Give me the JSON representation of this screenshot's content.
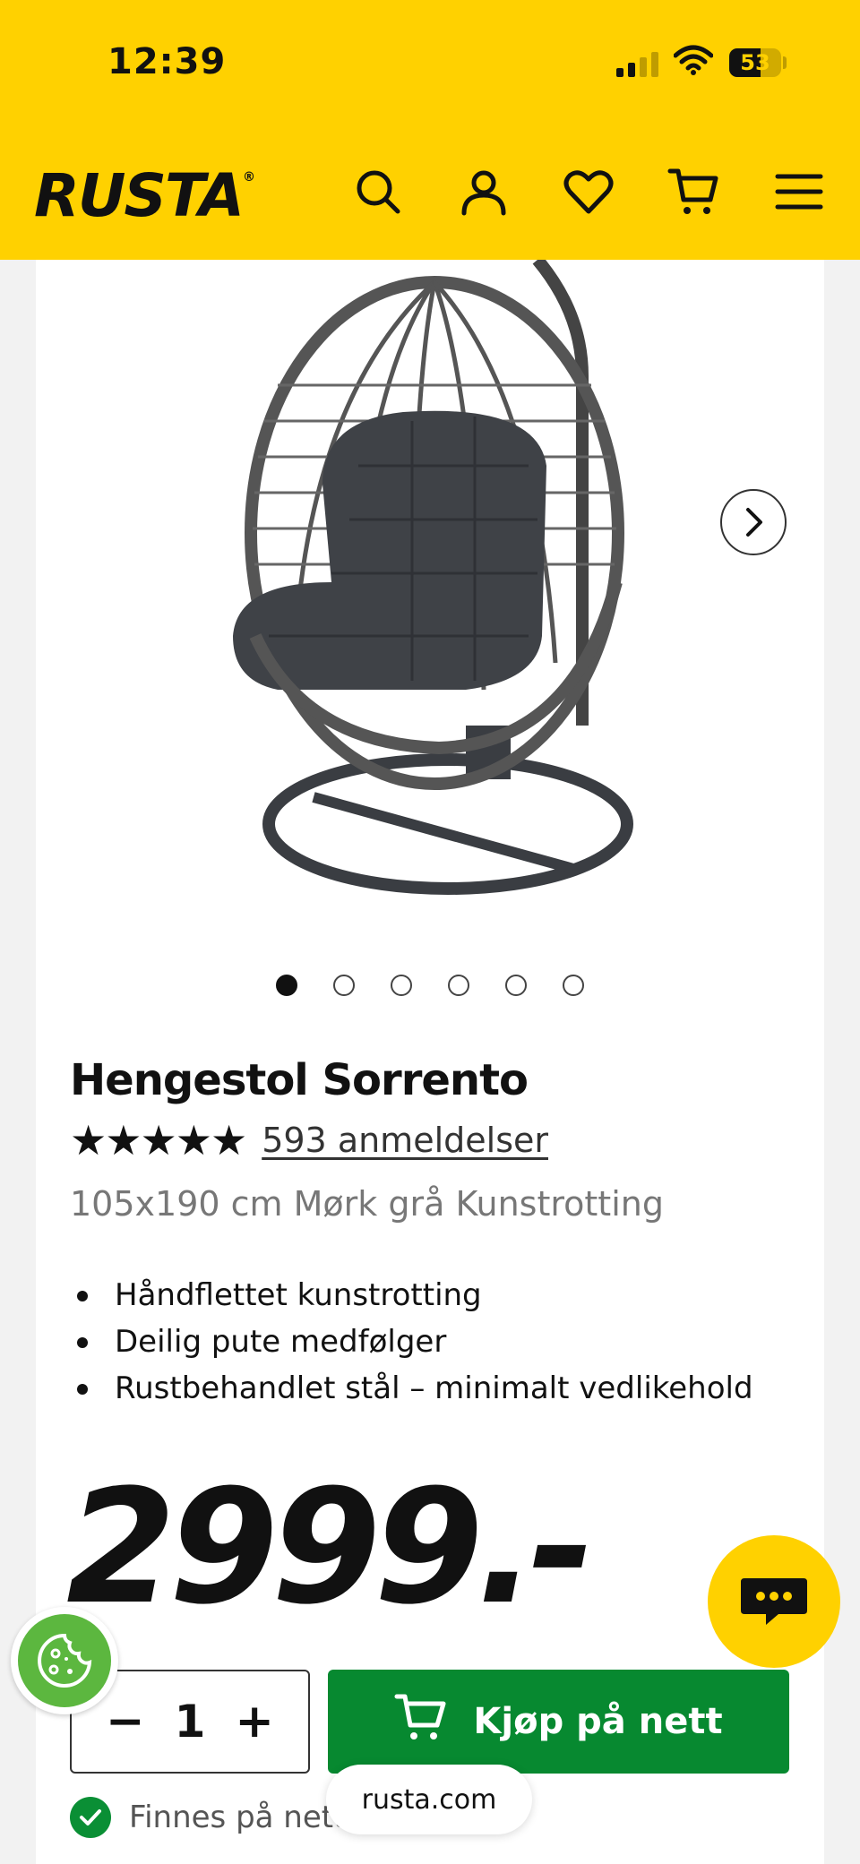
{
  "status_bar": {
    "time": "12:39",
    "battery": "53"
  },
  "header": {
    "logo": "RUSTA",
    "icons": [
      "search-icon",
      "account-icon",
      "heart-icon",
      "cart-icon",
      "menu-icon"
    ],
    "background": "#ffd100"
  },
  "gallery": {
    "slide_count": 6,
    "active_slide": 1
  },
  "product": {
    "title": "Hengestol Sorrento",
    "stars": "★★★★★",
    "rating": 5,
    "reviews": "593 anmeldelser",
    "variant": "105x190 cm Mørk grå Kunstrotting",
    "features": [
      "Håndflettet kunstrotting",
      "Deilig pute medfølger",
      "Rustbehandlet stål – minimalt vedlikehold"
    ],
    "price": "2999.-"
  },
  "purchase": {
    "minus": "−",
    "quantity": "1",
    "plus": "+",
    "buy_label": "Kjøp på nett",
    "buy_color": "#078930",
    "stock_text": "Finnes på nett"
  },
  "browser": {
    "url": "rusta.com"
  }
}
